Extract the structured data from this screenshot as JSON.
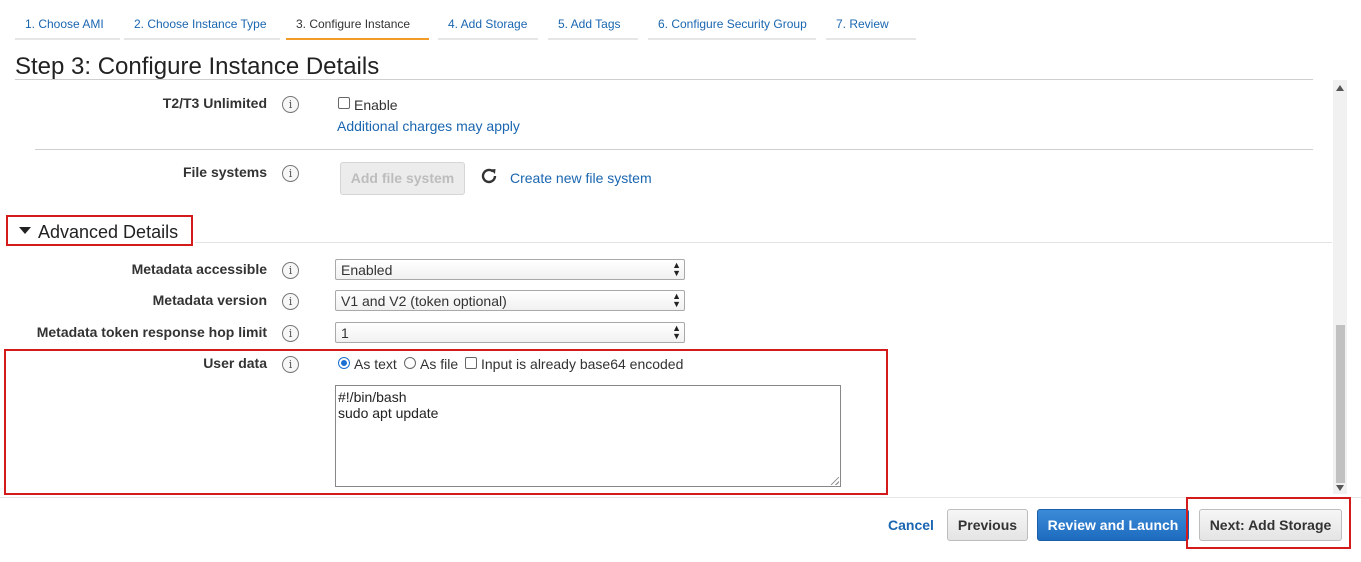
{
  "tabs": [
    {
      "label": "1. Choose AMI"
    },
    {
      "label": "2. Choose Instance Type"
    },
    {
      "label": "3. Configure Instance"
    },
    {
      "label": "4. Add Storage"
    },
    {
      "label": "5. Add Tags"
    },
    {
      "label": "6. Configure Security Group"
    },
    {
      "label": "7. Review"
    }
  ],
  "page": {
    "title": "Step 3: Configure Instance Details"
  },
  "t2t3": {
    "label": "T2/T3 Unlimited",
    "enable_label": "Enable",
    "enable_checked": false,
    "charges_link": "Additional charges may apply"
  },
  "file_systems": {
    "label": "File systems",
    "add_button": "Add file system",
    "create_link": "Create new file system"
  },
  "advanced": {
    "title": "Advanced Details",
    "expanded": true
  },
  "metadata": {
    "accessible": {
      "label": "Metadata accessible",
      "value": "Enabled"
    },
    "version": {
      "label": "Metadata version",
      "value": "V1 and V2 (token optional)"
    },
    "hop_limit": {
      "label": "Metadata token response hop limit",
      "value": "1"
    }
  },
  "user_data": {
    "label": "User data",
    "as_text": "As text",
    "as_file": "As file",
    "base64": "Input is already base64 encoded",
    "selected": "As text",
    "lines": [
      "#!/bin/bash",
      "sudo apt update"
    ]
  },
  "footer": {
    "cancel": "Cancel",
    "previous": "Previous",
    "review": "Review and Launch",
    "next": "Next: Add Storage"
  },
  "colors": {
    "accent": "#f39b27",
    "link": "#1a66b0",
    "primary": "#1e6bbf",
    "highlight": "#d31b1b"
  }
}
